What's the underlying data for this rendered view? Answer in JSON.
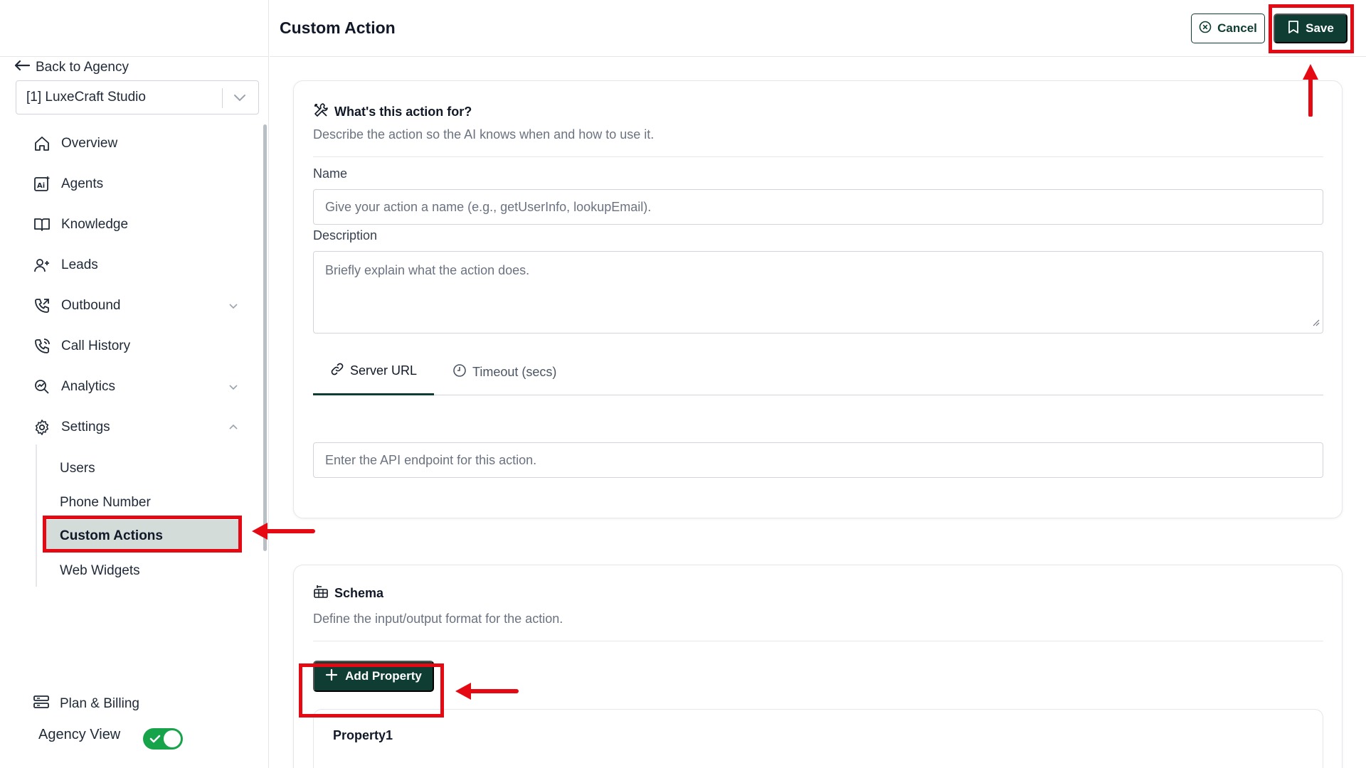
{
  "sidebar": {
    "back_label": "Back to Agency",
    "org_selected": "[1] LuxeCraft Studio",
    "items": [
      {
        "label": "Overview"
      },
      {
        "label": "Agents"
      },
      {
        "label": "Knowledge"
      },
      {
        "label": "Leads"
      },
      {
        "label": "Outbound"
      },
      {
        "label": "Call History"
      },
      {
        "label": "Analytics"
      },
      {
        "label": "Settings"
      }
    ],
    "settings_sub": [
      {
        "label": "Users"
      },
      {
        "label": "Phone Number"
      },
      {
        "label": "Custom Actions"
      },
      {
        "label": "Web Widgets"
      }
    ],
    "plan_label": "Plan & Billing",
    "agency_view_label": "Agency View",
    "agency_view_on": true
  },
  "header": {
    "title": "Custom Action",
    "cancel_label": "Cancel",
    "save_label": "Save"
  },
  "action_card": {
    "title": "What's this action for?",
    "description": "Describe the action so the AI knows when and how to use it.",
    "name_label": "Name",
    "name_placeholder": "Give your action a name (e.g., getUserInfo, lookupEmail).",
    "desc_label": "Description",
    "desc_placeholder": "Briefly explain what the action does.",
    "tabs": [
      {
        "label": "Server URL",
        "active": true
      },
      {
        "label": "Timeout (secs)",
        "active": false
      }
    ],
    "url_placeholder": "Enter the API endpoint for this action."
  },
  "schema_card": {
    "title": "Schema",
    "description": "Define the input/output format for the action.",
    "add_label": "Add Property",
    "property_name": "Property1"
  },
  "colors": {
    "primary": "#0f3d33",
    "annotation": "#e50914",
    "active_bg": "#d3dcd9",
    "toggle_on": "#16a34a"
  }
}
